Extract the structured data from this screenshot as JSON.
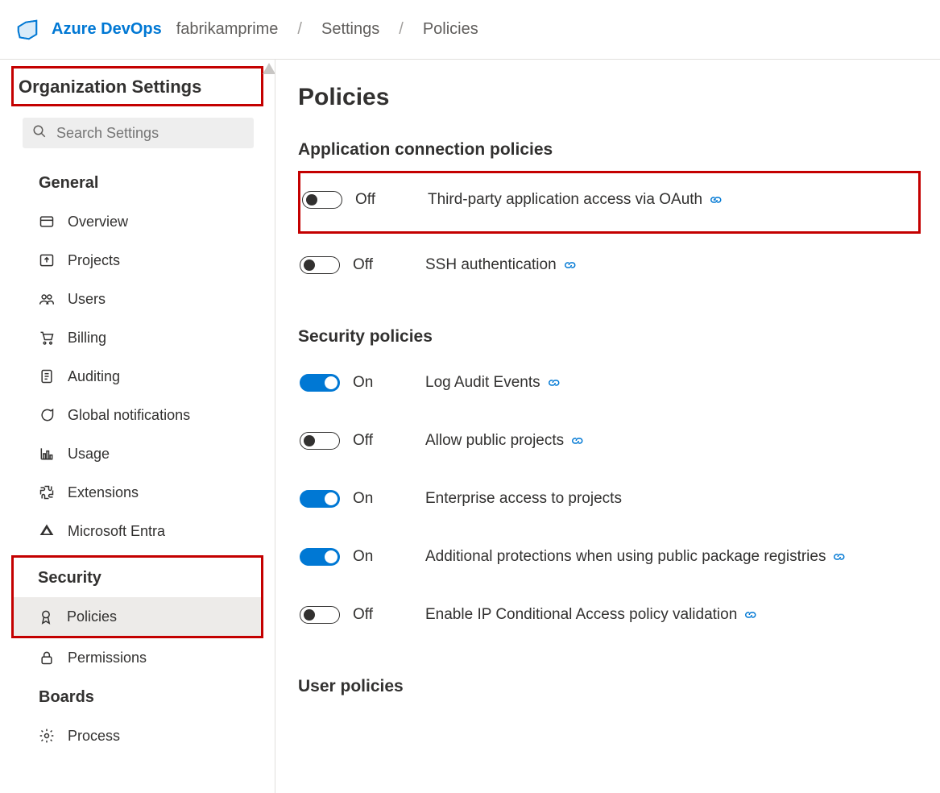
{
  "topbar": {
    "brand": "Azure DevOps",
    "crumbs": [
      "fabrikamprime",
      "Settings",
      "Policies"
    ]
  },
  "sidebar": {
    "title": "Organization Settings",
    "search_placeholder": "Search Settings",
    "sections": [
      {
        "title": "General",
        "items": [
          {
            "label": "Overview",
            "icon": "card-icon"
          },
          {
            "label": "Projects",
            "icon": "upload-icon"
          },
          {
            "label": "Users",
            "icon": "users-icon"
          },
          {
            "label": "Billing",
            "icon": "cart-icon"
          },
          {
            "label": "Auditing",
            "icon": "document-icon"
          },
          {
            "label": "Global notifications",
            "icon": "chat-icon"
          },
          {
            "label": "Usage",
            "icon": "chart-icon"
          },
          {
            "label": "Extensions",
            "icon": "puzzle-icon"
          },
          {
            "label": "Microsoft Entra",
            "icon": "entra-icon"
          }
        ]
      },
      {
        "title": "Security",
        "highlight": true,
        "items": [
          {
            "label": "Policies",
            "icon": "badge-icon",
            "selected": true
          },
          {
            "label": "Permissions",
            "icon": "lock-icon"
          }
        ]
      },
      {
        "title": "Boards",
        "items": [
          {
            "label": "Process",
            "icon": "gear-icon"
          }
        ]
      }
    ]
  },
  "main": {
    "title": "Policies",
    "groups": [
      {
        "title": "Application connection policies",
        "items": [
          {
            "on": false,
            "state": "Off",
            "label": "Third-party application access via OAuth",
            "link": true,
            "boxed": true
          },
          {
            "on": false,
            "state": "Off",
            "label": "SSH authentication",
            "link": true
          }
        ]
      },
      {
        "title": "Security policies",
        "items": [
          {
            "on": true,
            "state": "On",
            "label": "Log Audit Events",
            "link": true
          },
          {
            "on": false,
            "state": "Off",
            "label": "Allow public projects",
            "link": true
          },
          {
            "on": true,
            "state": "On",
            "label": "Enterprise access to projects",
            "link": false
          },
          {
            "on": true,
            "state": "On",
            "label": "Additional protections when using public package registries",
            "link": true
          },
          {
            "on": false,
            "state": "Off",
            "label": "Enable IP Conditional Access policy validation",
            "link": true
          }
        ]
      },
      {
        "title": "User policies",
        "items": []
      }
    ]
  }
}
